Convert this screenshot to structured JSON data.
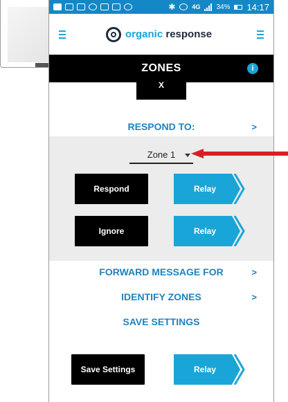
{
  "status_bar": {
    "battery": "34%",
    "time": "14:17",
    "network": "4G"
  },
  "header": {
    "logo_word1": "organic",
    "logo_word2": " response"
  },
  "title_bar": {
    "title": "ZONES",
    "info": "i"
  },
  "x_button": {
    "label": "X"
  },
  "respond_to": {
    "label": "RESPOND TO:",
    "chevron": ">"
  },
  "zone_select": {
    "value": "Zone 1"
  },
  "respond_row": {
    "action_label": "Respond",
    "relay_label": "Relay"
  },
  "ignore_row": {
    "action_label": "Ignore",
    "relay_label": "Relay"
  },
  "forward_message": {
    "label": "FORWARD MESSAGE FOR",
    "chevron": ">"
  },
  "identify_zones": {
    "label": "IDENTIFY ZONES",
    "chevron": ">"
  },
  "save_settings_header": {
    "label": "SAVE SETTINGS"
  },
  "save_row": {
    "action_label": "Save Settings",
    "relay_label": "Relay"
  },
  "colors": {
    "accent": "#1aa5d8",
    "status_bar": "#1488c6",
    "title_bar": "#000000",
    "pointer_arrow": "#d91f26"
  }
}
